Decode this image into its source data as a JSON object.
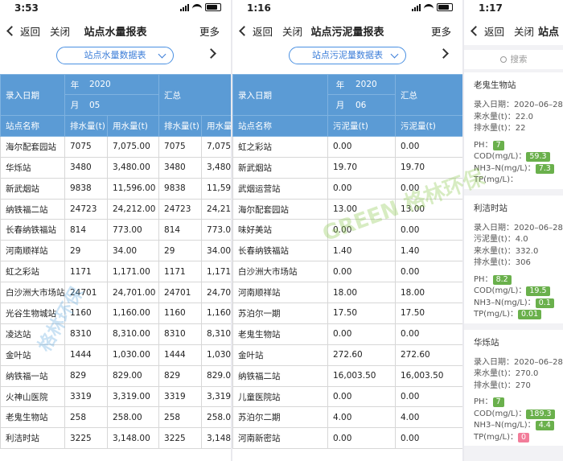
{
  "panel1": {
    "time": "3:53",
    "back": "返回",
    "close": "关闭",
    "title": "站点水量报表",
    "more": "更多",
    "selector": "站点水量数据表",
    "hdr": {
      "entry_date": "录入日期",
      "year_label": "年",
      "year": "2020",
      "month_label": "月",
      "month": "05",
      "summary": "汇总"
    },
    "columns": [
      "站点名称",
      "排水量(t)",
      "用水量(t)",
      "排水量(t)",
      "用水量(t"
    ],
    "rows": [
      [
        "海尔配套园站",
        "7075",
        "7,075.00",
        "7075",
        "7,075.0"
      ],
      [
        "华烁站",
        "3480",
        "3,480.00",
        "3480",
        "3,480.0"
      ],
      [
        "新武烟站",
        "9838",
        "11,596.00",
        "9838",
        "11,596."
      ],
      [
        "纳铁福二站",
        "24723",
        "24,212.00",
        "24723",
        "24,212"
      ],
      [
        "长春纳铁福站",
        "814",
        "773.00",
        "814",
        "773.00"
      ],
      [
        "河南顺祥站",
        "29",
        "34.00",
        "29",
        "34.00"
      ],
      [
        "虹之彩站",
        "1171",
        "1,171.00",
        "1171",
        "1,171.0"
      ],
      [
        "白沙洲大市场站",
        "24701",
        "24,701.00",
        "24701",
        "24,701."
      ],
      [
        "光谷生物城站",
        "1160",
        "1,160.00",
        "1160",
        "1,160.0"
      ],
      [
        "凌达站",
        "8310",
        "8,310.00",
        "8310",
        "8,310.0"
      ],
      [
        "金叶站",
        "1444",
        "1,030.00",
        "1444",
        "1,030.0"
      ],
      [
        "纳铁福一站",
        "829",
        "829.00",
        "829",
        "829.00"
      ],
      [
        "火神山医院",
        "3319",
        "3,319.00",
        "3319",
        "3,319.0"
      ],
      [
        "老鬼生物站",
        "258",
        "258.00",
        "258",
        "258.00"
      ],
      [
        "利洁时站",
        "3225",
        "3,148.00",
        "3225",
        "3,148.0"
      ]
    ]
  },
  "panel2": {
    "time": "1:16",
    "back": "返回",
    "close": "关闭",
    "title": "站点污泥量报表",
    "more": "更多",
    "selector": "站点污泥量数据表",
    "hdr": {
      "entry_date": "录入日期",
      "year_label": "年",
      "year": "2020",
      "month_label": "月",
      "month": "06",
      "summary": "汇总"
    },
    "columns": [
      "站点名称",
      "污泥量(t)",
      "污泥量(t)"
    ],
    "rows": [
      [
        "虹之彩站",
        "0.00",
        "0.00"
      ],
      [
        "新武烟站",
        "19.70",
        "19.70"
      ],
      [
        "武烟运营站",
        "0.00",
        "0.00"
      ],
      [
        "海尔配套园站",
        "13.00",
        "13.00"
      ],
      [
        "味好美站",
        "0.00",
        "0.00"
      ],
      [
        "长春纳铁福站",
        "1.40",
        "1.40"
      ],
      [
        "白沙洲大市场站",
        "0.00",
        "0.00"
      ],
      [
        "河南顺祥站",
        "18.00",
        "18.00"
      ],
      [
        "苏泊尔一期",
        "17.50",
        "17.50"
      ],
      [
        "老鬼生物站",
        "0.00",
        "0.00"
      ],
      [
        "金叶站",
        "272.60",
        "272.60"
      ],
      [
        "纳铁福二站",
        "16,003.50",
        "16,003.50"
      ],
      [
        "儿童医院站",
        "0.00",
        "0.00"
      ],
      [
        "苏泊尔二期",
        "4.00",
        "4.00"
      ],
      [
        "河南新密站",
        "0.00",
        "0.00"
      ]
    ]
  },
  "panel3": {
    "time": "1:17",
    "back": "返回",
    "close": "关闭",
    "title": "站点",
    "search_placeholder": "搜索",
    "cards": [
      {
        "name": "老鬼生物站",
        "lines": [
          "录入日期：2020–06–28",
          "来水量(t)：22.0",
          "排水量(t)：22"
        ],
        "ph_label": "PH：",
        "ph": "7",
        "cod_label": "COD(mg/L)：",
        "cod": "59.3",
        "nh3_label": "NH3–N(mg/L)：",
        "nh3": "7.3",
        "tp_label": "TP(mg/L)：",
        "tp": ""
      },
      {
        "name": "利洁时站",
        "lines": [
          "录入日期：2020–06–28",
          "污泥量(t)：4.0",
          "来水量(t)：332.0",
          "排水量(t)：306"
        ],
        "ph_label": "PH：",
        "ph": "8.2",
        "cod_label": "COD(mg/L)：",
        "cod": "19.5",
        "nh3_label": "NH3–N(mg/L)：",
        "nh3": "0.1",
        "tp_label": "TP(mg/L)：",
        "tp": "0.01"
      },
      {
        "name": "华烁站",
        "lines": [
          "录入日期：2020–06–28",
          "来水量(t)：270.0",
          "排水量(t)：270"
        ],
        "ph_label": "PH：",
        "ph": "7",
        "cod_label": "COD(mg/L)：",
        "cod": "189.3",
        "nh3_label": "NH3–N(mg/L)：",
        "nh3": "4.4",
        "tp_label": "TP(mg/L)：",
        "tp": "0"
      }
    ]
  },
  "watermark": {
    "en": "GREEN",
    "cn": "格林环保",
    "cn2": "格林环保"
  }
}
